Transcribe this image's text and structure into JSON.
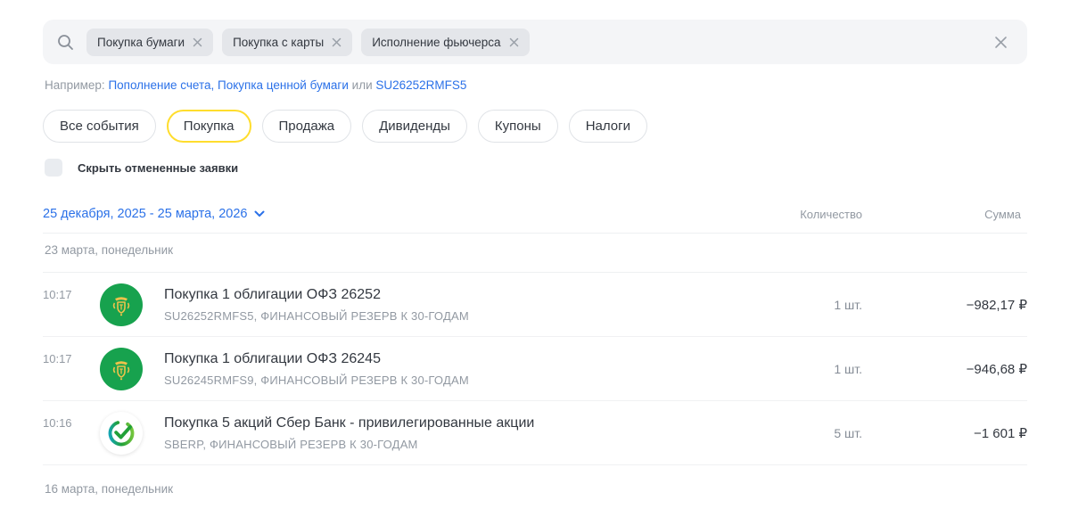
{
  "colors": {
    "accent_yellow": "#ffdd2d",
    "link_blue": "#2b71e8",
    "bond_green": "#17a24e",
    "sber_green": "#21a038",
    "sber_blue": "#10a7df"
  },
  "search": {
    "chips": [
      {
        "label": "Покупка бумаги"
      },
      {
        "label": "Покупка с карты"
      },
      {
        "label": "Исполнение фьючерса"
      }
    ]
  },
  "hint": {
    "prefix": "Например:",
    "link_examples": "Пополнение счета, Покупка ценной бумаги",
    "connector": "или",
    "link_ticker": "SU26252RMFS5"
  },
  "filters": [
    {
      "label": "Все события",
      "active": false
    },
    {
      "label": "Покупка",
      "active": true
    },
    {
      "label": "Продажа",
      "active": false
    },
    {
      "label": "Дивиденды",
      "active": false
    },
    {
      "label": "Купоны",
      "active": false
    },
    {
      "label": "Налоги",
      "active": false
    }
  ],
  "hide_cancelled": {
    "label": "Скрыть отмененные заявки",
    "checked": false
  },
  "period": {
    "range": "25 декабря, 2025 - 25 марта, 2026"
  },
  "columns": {
    "quantity": "Количество",
    "amount": "Сумма"
  },
  "groups": [
    {
      "date_label": "23 марта, понедельник",
      "rows": [
        {
          "time": "10:17",
          "icon": "minfin-crest",
          "title": "Покупка 1 облигации ОФЗ 26252",
          "subtitle": "SU26252RMFS5, ФИНАНСОВЫЙ РЕЗЕРВ К 30-ГОДАМ",
          "quantity": "1 шт.",
          "amount": "−982,17 ₽"
        },
        {
          "time": "10:17",
          "icon": "minfin-crest",
          "title": "Покупка 1 облигации ОФЗ 26245",
          "subtitle": "SU26245RMFS9, ФИНАНСОВЫЙ РЕЗЕРВ К 30-ГОДАМ",
          "quantity": "1 шт.",
          "amount": "−946,68 ₽"
        },
        {
          "time": "10:16",
          "icon": "sber-logo",
          "title": "Покупка 5 акций Сбер Банк - привилегированные акции",
          "subtitle": "SBERP, ФИНАНСОВЫЙ РЕЗЕРВ К 30-ГОДАМ",
          "quantity": "5 шт.",
          "amount": "−1 601 ₽"
        }
      ]
    },
    {
      "date_label": "16 марта, понедельник",
      "rows": []
    }
  ]
}
